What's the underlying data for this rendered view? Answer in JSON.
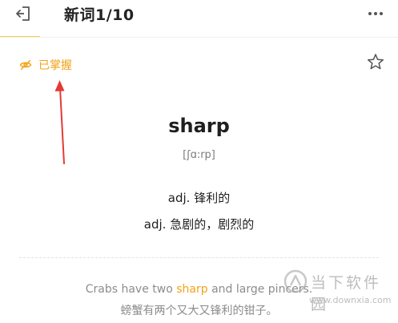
{
  "header": {
    "title": "新词1/10",
    "back_icon": "exit-icon",
    "more_icon": "more-vertical-icon",
    "accent_underline": "#f6cf4a"
  },
  "status": {
    "mastered_label": "已掌握",
    "icon": "eye-off-icon",
    "color": "#f2a216"
  },
  "favorite": {
    "icon": "star-outline-icon"
  },
  "annotation": {
    "arrow_color": "#e53935"
  },
  "word": {
    "text": "sharp",
    "phonetic": "[ʃɑ:rp]",
    "definitions": [
      "adj. 锋利的",
      "adj. 急剧的，剧烈的"
    ]
  },
  "example": {
    "en_before": "Crabs have two ",
    "en_highlight": "sharp",
    "en_after": " and large pincers.",
    "zh": "螃蟹有两个又大又锋利的钳子。"
  },
  "watermark": {
    "cn": "当下软件园",
    "url": "www.downxia.com"
  }
}
